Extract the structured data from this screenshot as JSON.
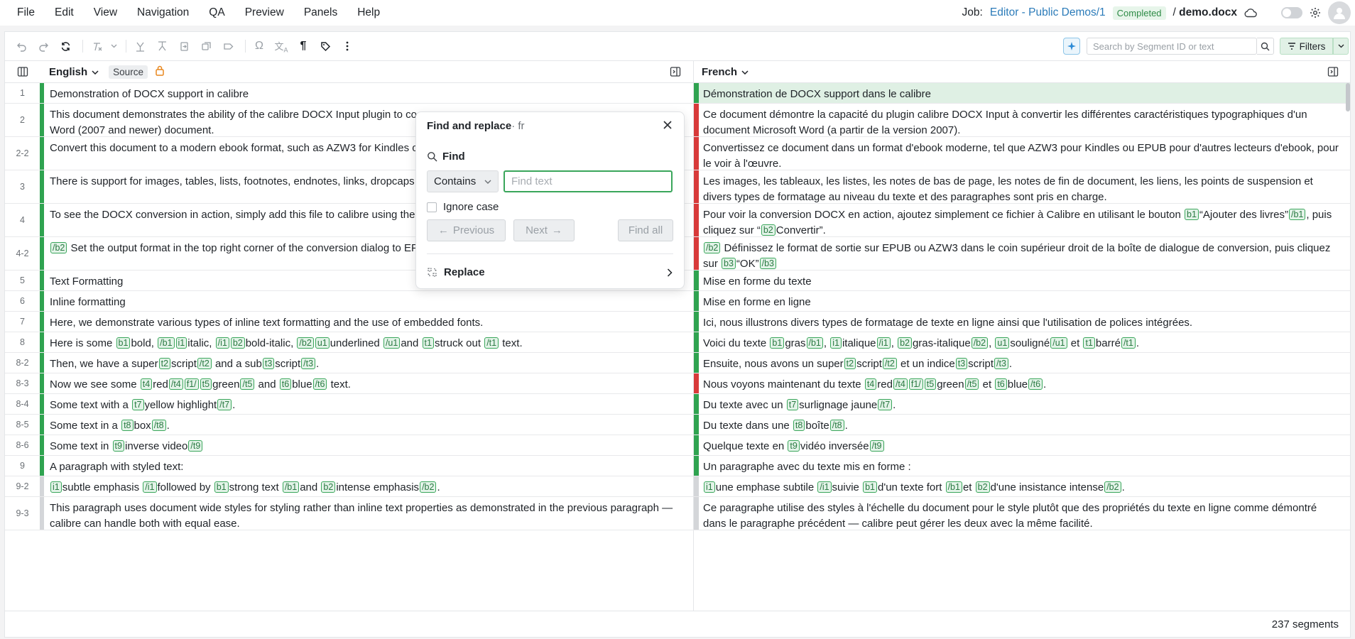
{
  "menu": [
    "File",
    "Edit",
    "View",
    "Navigation",
    "QA",
    "Preview",
    "Panels",
    "Help"
  ],
  "job": {
    "label": "Job:",
    "project": "Editor - Public Demos/1",
    "status": "Completed",
    "file_sep": "/",
    "file": "demo.docx"
  },
  "search": {
    "placeholder": "Search by Segment ID or text",
    "filters_label": "Filters"
  },
  "columns": {
    "source_lang": "English",
    "source_chip": "Source",
    "target_lang": "French"
  },
  "colors": {
    "confirmed": "#2fa350",
    "draft": "#d83a3a",
    "neutral": "#d4d6d9",
    "accent": "#3aa65b",
    "link": "#2b7bb9"
  },
  "segments": [
    {
      "id": "1",
      "src": "Demonstration of DOCX support in calibre",
      "tgt": "Démonstration de DOCX support dans le calibre",
      "sbar": "#2fa350",
      "tbar": "#2fa350",
      "hl": true
    },
    {
      "id": "2",
      "src": "This document demonstrates the ability of the calibre DOCX Input plugin to co",
      "src2": "Word (2007 and newer) document.",
      "tgt": "Ce document démontre la capacité du plugin calibre DOCX Input à convertir les différentes caractéristiques typographiques d'un document Microsoft Word (a partir de la version 2007).",
      "sbar": "#2fa350",
      "tbar": "#d83a3a"
    },
    {
      "id": "2-2",
      "src": "Convert this document to a modern ebook format, such as AZW3 for Kindles o",
      "tgt": "Convertissez ce document dans un format d'ebook moderne, tel que AZW3 pour Kindles ou EPUB pour d'autres lecteurs d'ebook, pour le voir à l'œuvre.",
      "sbar": "#2fa350",
      "tbar": "#d83a3a"
    },
    {
      "id": "3",
      "src": "There is support for images, tables, lists, footnotes, endnotes, links, dropcaps",
      "tgt": "Les images, les tableaux, les listes, les notes de bas de page, les notes de fin de document, les liens, les points de suspension et divers types de formatage au niveau du texte et des paragraphes sont pris en charge.",
      "sbar": "#2fa350",
      "tbar": "#d83a3a"
    },
    {
      "id": "4",
      "src": "To see the DOCX conversion in action, simply add this file to calibre using the",
      "tgt": "",
      "sbar": "#2fa350",
      "tbar": "#d83a3a"
    },
    {
      "id": "4-2",
      "src": "",
      "tgt": "",
      "sbar": "#2fa350",
      "tbar": "#d83a3a"
    },
    {
      "id": "5",
      "src": "Text Formatting",
      "tgt": "Mise en forme du texte",
      "sbar": "#2fa350",
      "tbar": "#2fa350"
    },
    {
      "id": "6",
      "src": "Inline formatting",
      "tgt": "Mise en forme en ligne",
      "sbar": "#2fa350",
      "tbar": "#2fa350"
    },
    {
      "id": "7",
      "src": "Here, we demonstrate various types of inline text formatting and the use of embedded fonts.",
      "tgt": "Ici, nous illustrons divers types de formatage de texte en ligne ainsi que l'utilisation de polices intégrées.",
      "sbar": "#2fa350",
      "tbar": "#2fa350"
    },
    {
      "id": "8",
      "src": "",
      "tgt": "",
      "sbar": "#2fa350",
      "tbar": "#2fa350"
    },
    {
      "id": "8-2",
      "src": "",
      "tgt": "",
      "sbar": "#2fa350",
      "tbar": "#2fa350"
    },
    {
      "id": "8-3",
      "src": "",
      "tgt": "",
      "sbar": "#2fa350",
      "tbar": "#d83a3a"
    },
    {
      "id": "8-4",
      "src": "",
      "tgt": "",
      "sbar": "#2fa350",
      "tbar": "#2fa350"
    },
    {
      "id": "8-5",
      "src": "",
      "tgt": "",
      "sbar": "#2fa350",
      "tbar": "#2fa350"
    },
    {
      "id": "8-6",
      "src": "",
      "tgt": "",
      "sbar": "#2fa350",
      "tbar": "#2fa350"
    },
    {
      "id": "9",
      "src": "A paragraph with styled text:",
      "tgt": "Un paragraphe avec du texte mis en forme :",
      "sbar": "#2fa350",
      "tbar": "#2fa350"
    },
    {
      "id": "9-2",
      "src": "",
      "tgt": "",
      "sbar": "#d4d6d9",
      "tbar": "#d4d6d9"
    },
    {
      "id": "9-3",
      "src": "This paragraph uses document wide styles for styling rather than inline text properties as demonstrated in the previous paragraph —",
      "src2": "calibre can handle both with equal ease.",
      "tgt": "Ce paragraphe utilise des styles à l'échelle du document pour le style plutôt que des propriétés du texte en ligne comme démontré dans le paragraphe précédent — calibre peut gérer les deux avec la même facilité.",
      "sbar": "#d4d6d9",
      "tbar": "#d4d6d9"
    }
  ],
  "rich": {
    "s4_tgt": [
      "Pour voir la conversion DOCX en action, ajoutez simplement ce fichier à Calibre en utilisant le bouton ",
      "b1",
      "“Ajouter des livres”",
      "/b1",
      ", puis cliquez sur “",
      "b2",
      "Convertir”."
    ],
    "s42_src": [
      "/b2",
      " Set the output format in the top right corner of the conversion dialog to EP"
    ],
    "s42_tgt": [
      "/b2",
      " Définissez le format de sortie sur EPUB ou AZW3 dans le coin supérieur droit de la boîte de dialogue de conversion, puis cliquez sur ",
      "b3",
      "“OK”",
      "/b3"
    ],
    "s8_src": [
      "Here is some ",
      "b1",
      "bold, ",
      "/b1",
      "i1",
      "italic, ",
      "/i1",
      "b2",
      "bold-italic, ",
      "/b2",
      "u1",
      "underlined ",
      "/u1",
      "and ",
      "t1",
      "struck out ",
      "/t1",
      " text."
    ],
    "s8_tgt": [
      "Voici du texte ",
      "b1",
      "gras",
      "/b1",
      ", ",
      "i1",
      "italique",
      "/i1",
      ", ",
      "b2",
      "gras-italique",
      "/b2",
      ", ",
      "u1",
      "souligné",
      "/u1",
      " et ",
      "t1",
      "barré",
      "/t1",
      "."
    ],
    "s82_src": [
      "Then, we have a super",
      "t2",
      "script",
      "/t2",
      " and a sub",
      "t3",
      "script",
      "/t3",
      "."
    ],
    "s82_tgt": [
      "Ensuite, nous avons un super",
      "t2",
      "script",
      "/t2",
      " et un indice",
      "t3",
      "script",
      "/t3",
      "."
    ],
    "s83_src": [
      "Now we see some ",
      "t4",
      "red",
      "/t4",
      "f1/",
      "t5",
      "green",
      "/t5",
      " and ",
      "t6",
      "blue",
      "/t6",
      " text."
    ],
    "s83_tgt": [
      "Nous voyons maintenant du texte ",
      "t4",
      "red",
      "/t4",
      "f1/",
      "t5",
      "green",
      "/t5",
      " et ",
      "t6",
      "blue",
      "/t6",
      "."
    ],
    "s84_src": [
      "Some text with a ",
      "t7",
      "yellow highlight",
      "/t7",
      "."
    ],
    "s84_tgt": [
      "Du texte avec un ",
      "t7",
      "surlignage jaune",
      "/t7",
      "."
    ],
    "s85_src": [
      "Some text in a ",
      "t8",
      "box",
      "/t8",
      "."
    ],
    "s85_tgt": [
      "Du texte dans une ",
      "t8",
      "boîte",
      "/t8",
      "."
    ],
    "s86_src": [
      "Some text in ",
      "t9",
      "inverse video",
      "/t9"
    ],
    "s86_tgt": [
      "Quelque texte en ",
      "t9",
      "vidéo inversée",
      "/t9"
    ],
    "s92_src": [
      "i1",
      "subtle emphasis  ",
      "/i1",
      "followed by ",
      "b1",
      "strong text ",
      "/b1",
      "and ",
      "b2",
      "intense emphasis",
      "/b2",
      "."
    ],
    "s92_tgt": [
      "i1",
      "une emphase subtile  ",
      "/i1",
      "suivie ",
      "b1",
      "d'un texte fort ",
      "/b1",
      "et ",
      "b2",
      "d'une insistance intense",
      "/b2",
      "."
    ]
  },
  "dialog": {
    "title": "Find and replace",
    "lang": "· fr",
    "find_label": "Find",
    "mode": "Contains",
    "placeholder": "Find text",
    "ignore_case": "Ignore case",
    "previous": "Previous",
    "next": "Next",
    "find_all": "Find all",
    "replace": "Replace"
  },
  "footer": {
    "count": "237 segments"
  }
}
